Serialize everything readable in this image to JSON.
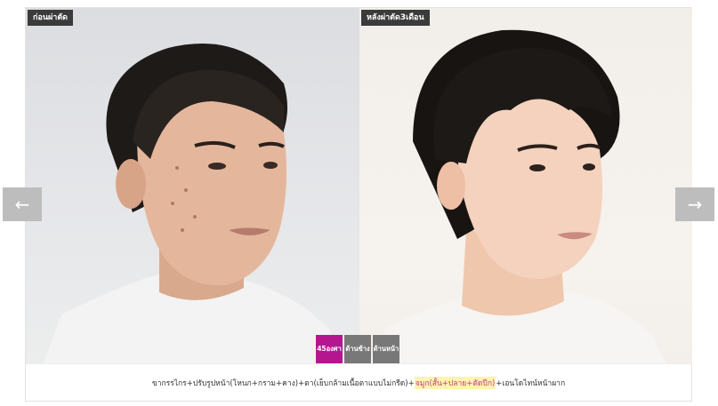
{
  "before_label": "ก่อนผ่าตัด",
  "after_label": "หลังผ่าตัด3เดือน",
  "view_tabs": [
    {
      "label": "45องศา",
      "active": true
    },
    {
      "label": "ด้านข้าง",
      "active": false
    },
    {
      "label": "ด้านหน้า",
      "active": false
    }
  ],
  "caption": {
    "part1": "ขากรรไกร+ปรับรูปหน้า(โหนก+กราม+คาง)+ตา(เย็บกล้ามเนื้อตาแบบไม่กรีด)+",
    "highlight": "จมูก(สั้น+ปลาย+ตัดปีก)",
    "part2": "+เอนโดไทน์หน้าผาก"
  },
  "icons": {
    "prev": "arrow-left-icon",
    "next": "arrow-right-icon"
  },
  "colors": {
    "active_tab": "#b5168f",
    "inactive_tab": "#787878",
    "label_bg": "#3b3b3b",
    "arrow_bg": "#bdbdbd"
  }
}
